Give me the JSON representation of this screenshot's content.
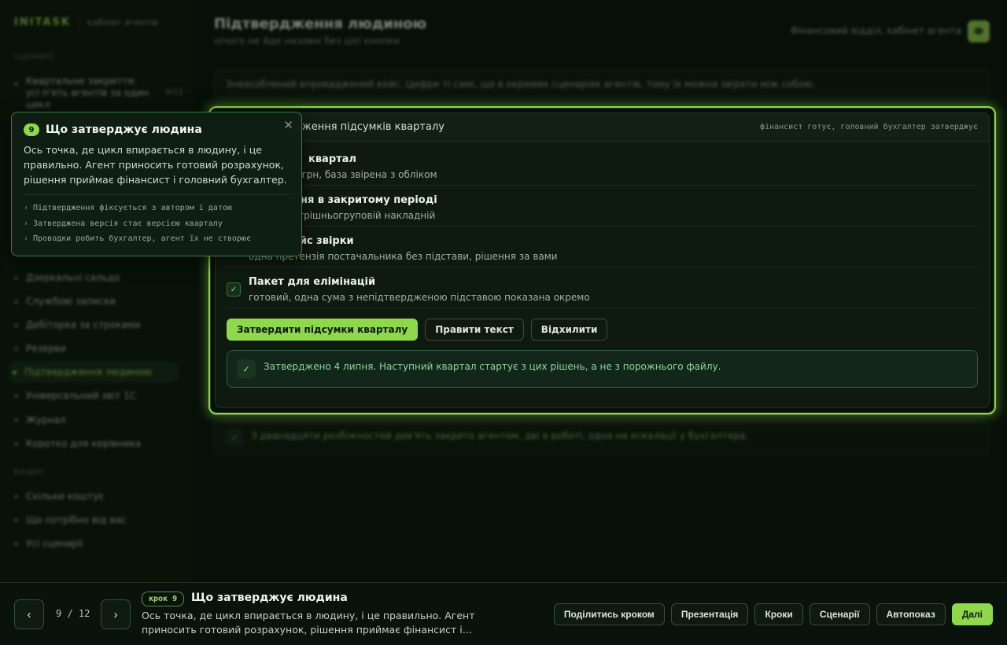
{
  "app": {
    "brand": "INITASK",
    "brand_sub": "кабінет агентів"
  },
  "sidebar": {
    "section1": "СЦЕНАРІЇ",
    "items": [
      {
        "label": "Квартальне закриття: усі п'ять агентів за один цикл",
        "count": "9/12"
      },
      {
        "label": "Дзеркальні сальдо"
      },
      {
        "label": "Службові записки"
      },
      {
        "label": "Дебіторка за строками"
      },
      {
        "label": "Резерви"
      },
      {
        "label": "Підтвердження людиною"
      },
      {
        "label": "Універсальний звіт 1С"
      },
      {
        "label": "Журнал"
      },
      {
        "label": "Коротко для керівника"
      }
    ],
    "section2": "ВХІДНІ",
    "items2": [
      {
        "label": "Скільки коштує"
      },
      {
        "label": "Що потрібно від вас"
      },
      {
        "label": "Усі сценарії"
      }
    ]
  },
  "header": {
    "title": "Підтвердження людиною",
    "subtitle": "нічого не йде назовні без цієї кнопки",
    "right": "Фінансовий відділ, кабінет агента",
    "avatar": "Ф"
  },
  "note": "Знеособлений впроваджений кейс. Цифри ті самі, що в окремих сценаріях агентів, тому їх можна звіряти між собою.",
  "card": {
    "title": "ження підсумків кварталу",
    "meta": "фінансист готує, головний бухгалтер затверджує",
    "items": [
      {
        "title": "квартал",
        "desc": "0 грн, база звірена з обліком"
      },
      {
        "title": "ння в закритому періоді",
        "desc": "утрішньогруповій накладній"
      },
      {
        "title": "ейс звірки",
        "desc": "одна претензія постачальника без підстави, рішення за вами"
      },
      {
        "title": "Пакет для елімінацій",
        "desc": "готовий, одна сума з непідтвердженою підставою показана окремо"
      }
    ],
    "actions": {
      "approve": "Затвердити підсумки кварталу",
      "edit": "Правити текст",
      "reject": "Відхилити"
    },
    "confirm": "Затверджено 4 липня. Наступний квартал стартує з цих рішень, а не з порожнього файлу."
  },
  "bottom_card": "З дванадцяти розбіжностей дев'ять закрито агентом, дві в роботі, одна на ескалації у бухгалтера.",
  "popover": {
    "number": "9",
    "title": "Що затверджує людина",
    "body": "Ось точка, де цикл впирається в людину, і це правильно. Агент приносить готовий розрахунок, рішення приймає фінансист і головний бухгалтер.",
    "points": [
      "Підтвердження фіксується з автором і датою",
      "Затверджена версія стає версією кварталу",
      "Проводки робить бухгалтер, агент їх не створює"
    ]
  },
  "bottombar": {
    "pager": "9 / 12",
    "step_badge": "крок 9",
    "step_title": "Що затверджує людина",
    "step_desc": "Ось точка, де цикл впирається в людину, і це правильно. Агент приносить готовий розрахунок, рішення приймає фінансист і…",
    "buttons": {
      "share": "Поділитись кроком",
      "presentation": "Презентація",
      "steps": "Кроки",
      "scenarios": "Сценарії",
      "autoplay": "Автопоказ",
      "next": "Далі"
    }
  },
  "colors": {
    "accent": "#8fd84c",
    "background": "#071008",
    "success_text": "#8fd6a0"
  },
  "icons": {
    "check": "✓",
    "close": "✕",
    "prev": "‹",
    "next": "›",
    "bullet_arrow": "›"
  }
}
